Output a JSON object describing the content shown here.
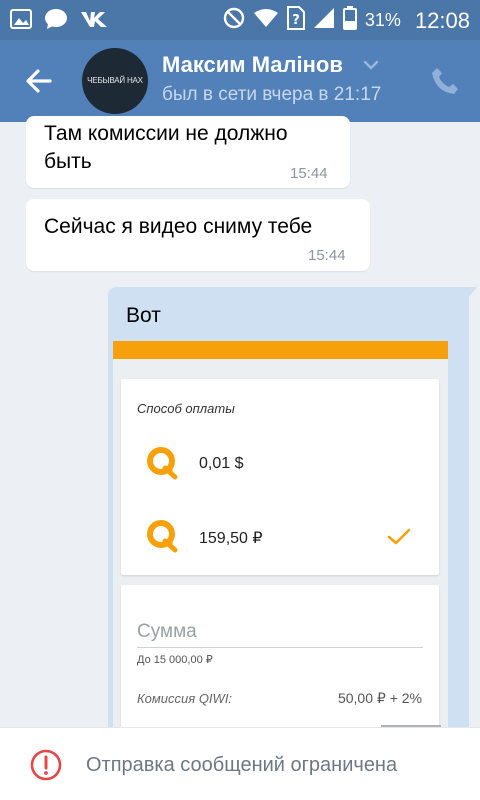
{
  "status_bar": {
    "icons_left": [
      "gallery-icon",
      "chat-icon",
      "vk-icon"
    ],
    "icons_right": [
      "do-not-disturb-icon",
      "wifi-icon",
      "sim-unknown-icon",
      "signal-icon",
      "battery-icon"
    ],
    "battery": "31%",
    "time": "12:08"
  },
  "header": {
    "avatar_text": "ЧЕБЫВАЙ НАХ",
    "name": "Максим Малiнов",
    "status": "был в сети вчера в 21:17"
  },
  "messages": [
    {
      "text": "Там комиссии не должно быть",
      "time": "15:44"
    },
    {
      "text": "Сейчас я видео сниму тебе",
      "time": "15:44"
    },
    {
      "text": "Вот"
    }
  ],
  "attachment": {
    "payment_method_title": "Способ оплаты",
    "options": [
      {
        "amount": "0,01 $",
        "selected": false
      },
      {
        "amount": "159,50 ₽",
        "selected": true
      }
    ],
    "sum_placeholder": "Сумма",
    "sum_limit": "До 15 000,00 ₽",
    "fee_label": "Комиссия QIWI:",
    "fee_value": "50,00 ₽ + 2%"
  },
  "restriction": {
    "text": "Отправка сообщений ограничена"
  },
  "colors": {
    "statusbar": "#4a76a8",
    "appbar": "#5181b8",
    "background": "#ecf0f4",
    "outgoing": "#cfe0f2",
    "qiwi_orange": "#f6a10b",
    "warning_red": "#e64646"
  }
}
